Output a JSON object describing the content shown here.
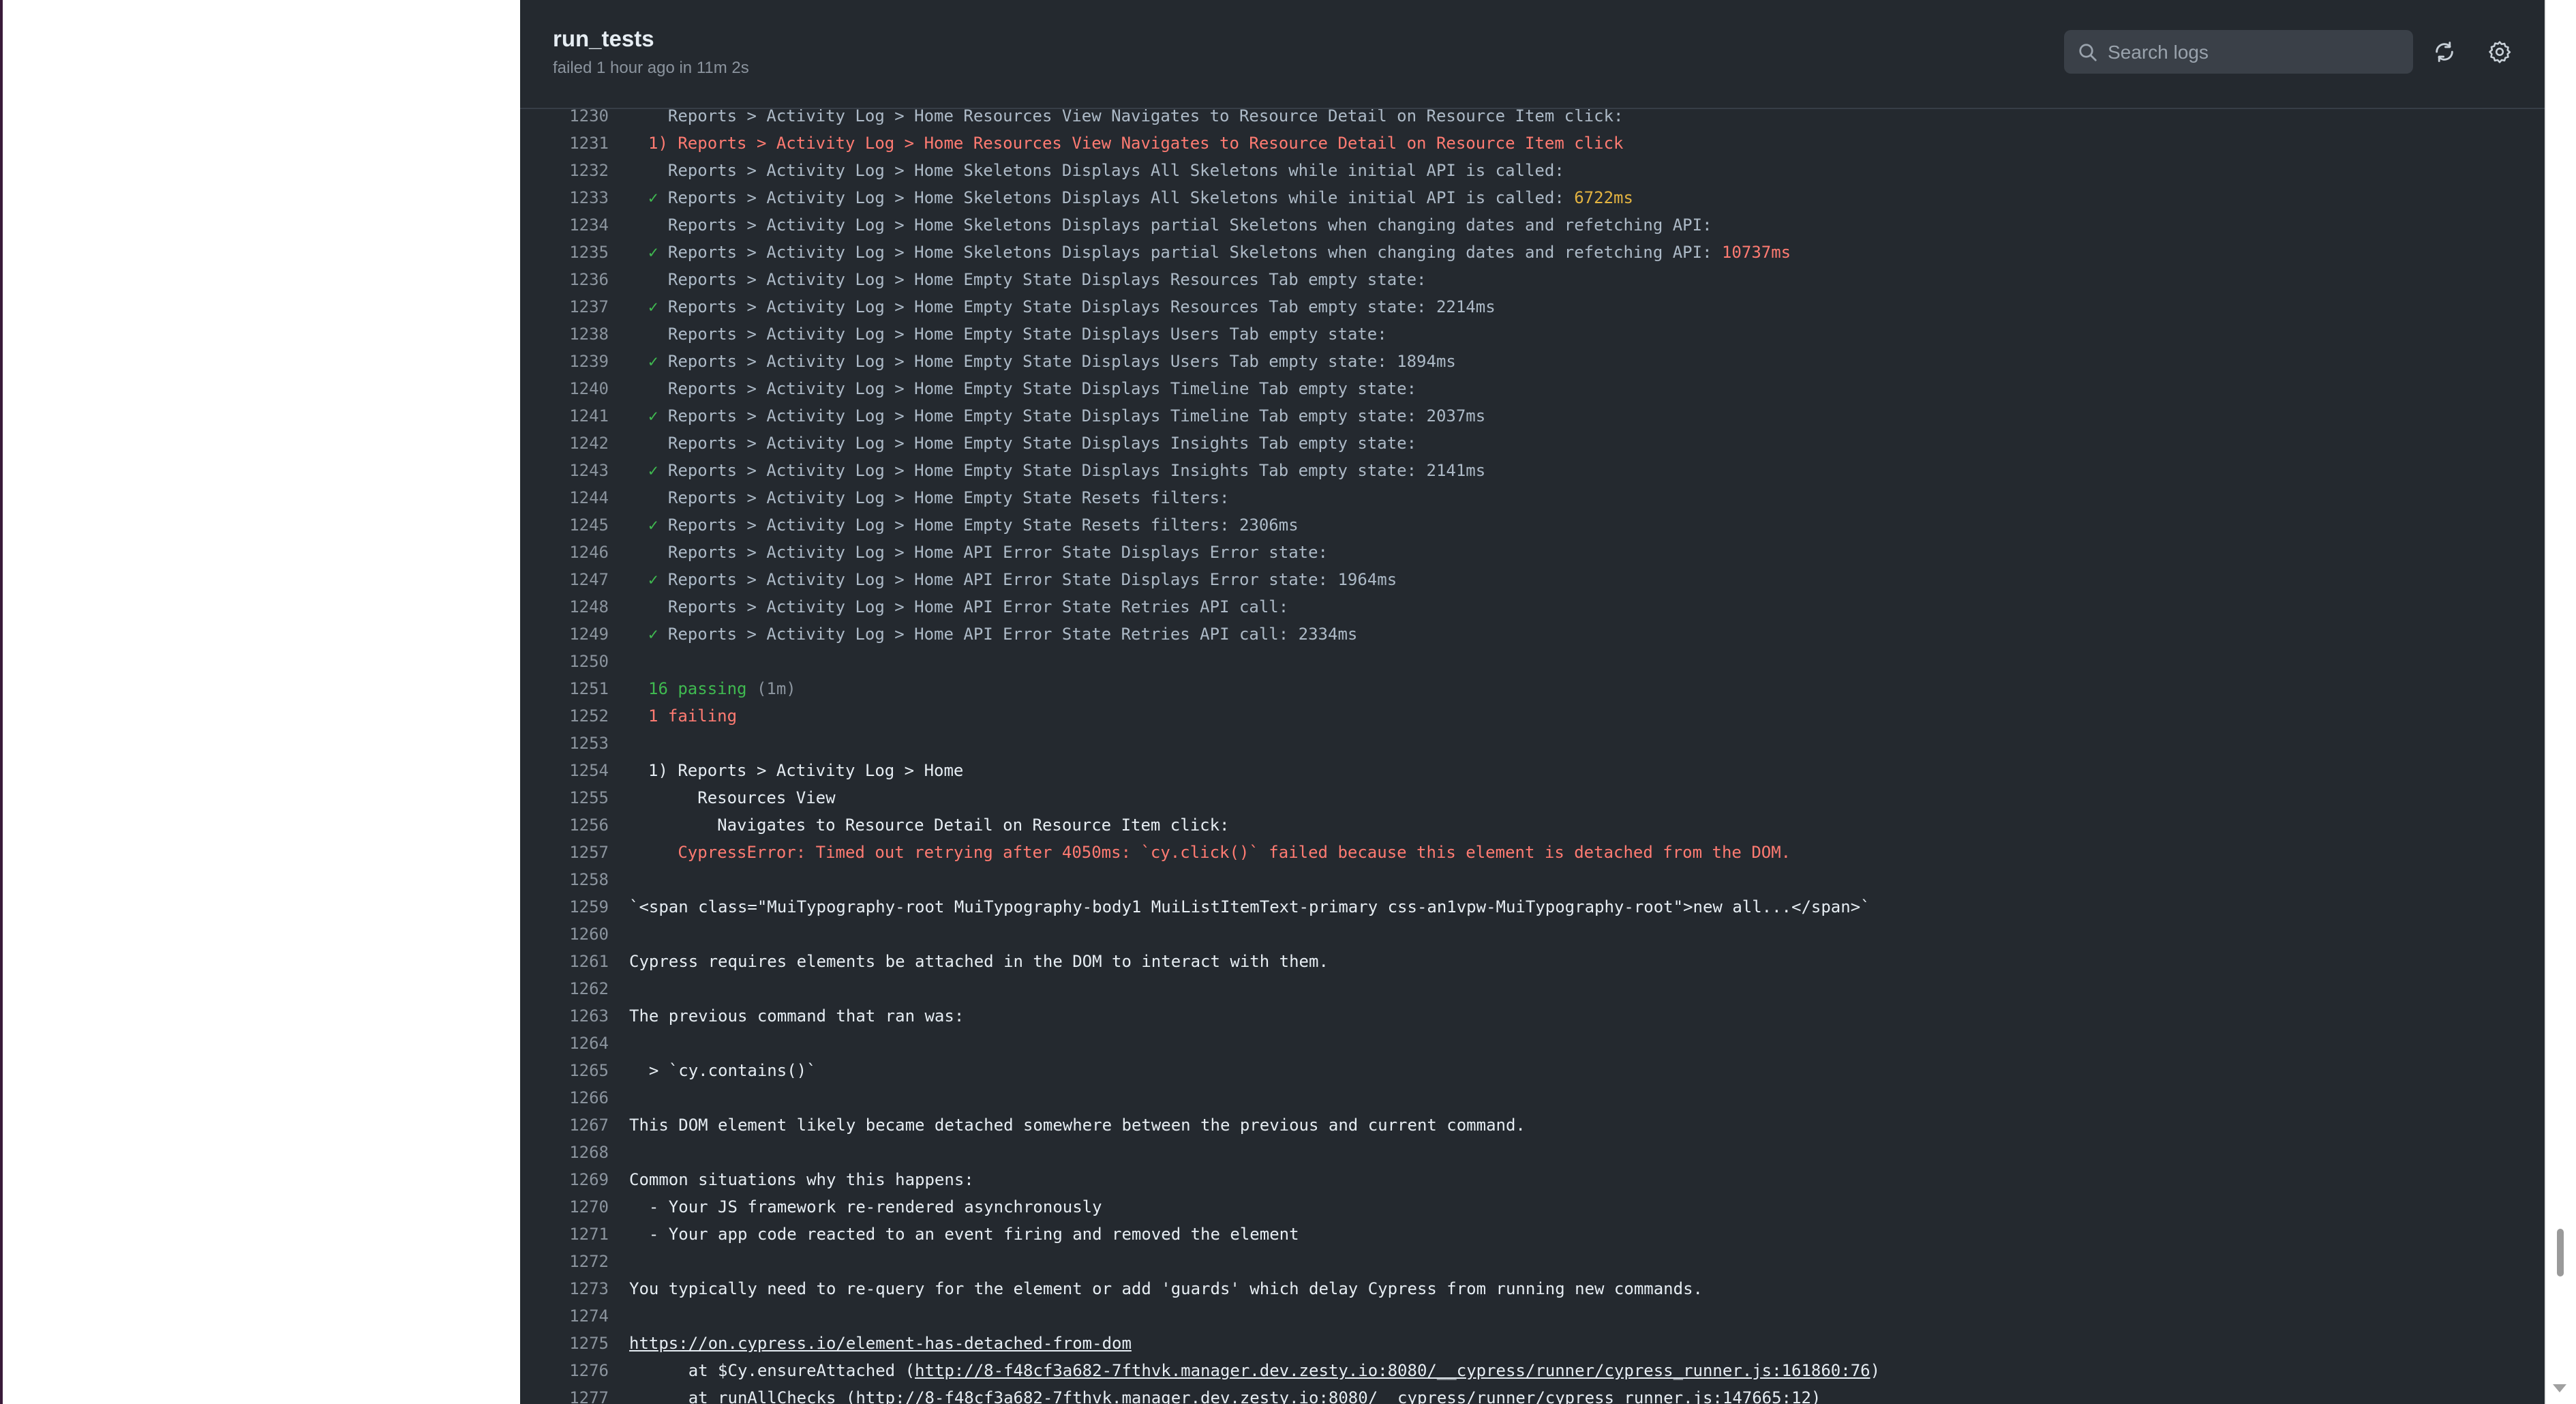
{
  "header": {
    "title": "run_tests",
    "status": "failed 1 hour ago in 11m 2s",
    "search_placeholder": "Search logs",
    "refresh_icon": "refresh-icon",
    "settings_icon": "gear-icon"
  },
  "colors": {
    "panel_bg": "#24292f",
    "fail_red": "#ff7b72",
    "pass_green": "#3fb950",
    "duration_yellow": "#e3b341"
  },
  "log": {
    "lines": [
      {
        "n": "1230",
        "parts": [
          {
            "t": "  Reports > Activity Log > Home Resources View Navigates to Resource Detail on Resource Item click:",
            "c": "dim"
          }
        ]
      },
      {
        "n": "1231",
        "parts": [
          {
            "t": "1) Reports > Activity Log > Home Resources View Navigates to Resource Detail on Resource Item click",
            "c": "red"
          }
        ]
      },
      {
        "n": "1232",
        "parts": [
          {
            "t": "  Reports > Activity Log > Home Skeletons Displays All Skeletons while initial API is called:",
            "c": "dim"
          }
        ]
      },
      {
        "n": "1233",
        "parts": [
          {
            "t": "✓ ",
            "c": "green"
          },
          {
            "t": "Reports > Activity Log > Home Skeletons Displays All Skeletons while initial API is called: ",
            "c": "dim"
          },
          {
            "t": "6722ms",
            "c": "yellow"
          }
        ]
      },
      {
        "n": "1234",
        "parts": [
          {
            "t": "  Reports > Activity Log > Home Skeletons Displays partial Skeletons when changing dates and refetching API:",
            "c": "dim"
          }
        ]
      },
      {
        "n": "1235",
        "parts": [
          {
            "t": "✓ ",
            "c": "green"
          },
          {
            "t": "Reports > Activity Log > Home Skeletons Displays partial Skeletons when changing dates and refetching API: ",
            "c": "dim"
          },
          {
            "t": "10737ms",
            "c": "red"
          }
        ]
      },
      {
        "n": "1236",
        "parts": [
          {
            "t": "  Reports > Activity Log > Home Empty State Displays Resources Tab empty state:",
            "c": "dim"
          }
        ]
      },
      {
        "n": "1237",
        "parts": [
          {
            "t": "✓ ",
            "c": "green"
          },
          {
            "t": "Reports > Activity Log > Home Empty State Displays Resources Tab empty state: 2214ms",
            "c": "dim"
          }
        ]
      },
      {
        "n": "1238",
        "parts": [
          {
            "t": "  Reports > Activity Log > Home Empty State Displays Users Tab empty state:",
            "c": "dim"
          }
        ]
      },
      {
        "n": "1239",
        "parts": [
          {
            "t": "✓ ",
            "c": "green"
          },
          {
            "t": "Reports > Activity Log > Home Empty State Displays Users Tab empty state: 1894ms",
            "c": "dim"
          }
        ]
      },
      {
        "n": "1240",
        "parts": [
          {
            "t": "  Reports > Activity Log > Home Empty State Displays Timeline Tab empty state:",
            "c": "dim"
          }
        ]
      },
      {
        "n": "1241",
        "parts": [
          {
            "t": "✓ ",
            "c": "green"
          },
          {
            "t": "Reports > Activity Log > Home Empty State Displays Timeline Tab empty state: 2037ms",
            "c": "dim"
          }
        ]
      },
      {
        "n": "1242",
        "parts": [
          {
            "t": "  Reports > Activity Log > Home Empty State Displays Insights Tab empty state:",
            "c": "dim"
          }
        ]
      },
      {
        "n": "1243",
        "parts": [
          {
            "t": "✓ ",
            "c": "green"
          },
          {
            "t": "Reports > Activity Log > Home Empty State Displays Insights Tab empty state: 2141ms",
            "c": "dim"
          }
        ]
      },
      {
        "n": "1244",
        "parts": [
          {
            "t": "  Reports > Activity Log > Home Empty State Resets filters:",
            "c": "dim"
          }
        ]
      },
      {
        "n": "1245",
        "parts": [
          {
            "t": "✓ ",
            "c": "green"
          },
          {
            "t": "Reports > Activity Log > Home Empty State Resets filters: 2306ms",
            "c": "dim"
          }
        ]
      },
      {
        "n": "1246",
        "parts": [
          {
            "t": "  Reports > Activity Log > Home API Error State Displays Error state:",
            "c": "dim"
          }
        ]
      },
      {
        "n": "1247",
        "parts": [
          {
            "t": "✓ ",
            "c": "green"
          },
          {
            "t": "Reports > Activity Log > Home API Error State Displays Error state: 1964ms",
            "c": "dim"
          }
        ]
      },
      {
        "n": "1248",
        "parts": [
          {
            "t": "  Reports > Activity Log > Home API Error State Retries API call:",
            "c": "dim"
          }
        ]
      },
      {
        "n": "1249",
        "parts": [
          {
            "t": "✓ ",
            "c": "green"
          },
          {
            "t": "Reports > Activity Log > Home API Error State Retries API call: 2334ms",
            "c": "dim"
          }
        ]
      },
      {
        "n": "1250",
        "parts": []
      },
      {
        "n": "1251",
        "parts": [
          {
            "t": "16 passing ",
            "c": "green"
          },
          {
            "t": "(1m)",
            "c": "gray"
          }
        ]
      },
      {
        "n": "1252",
        "parts": [
          {
            "t": "1 failing",
            "c": "red"
          }
        ]
      },
      {
        "n": "1253",
        "parts": []
      },
      {
        "n": "1254",
        "parts": [
          {
            "t": "1) Reports > Activity Log > Home",
            "c": "plain"
          }
        ]
      },
      {
        "n": "1255",
        "parts": [
          {
            "t": "     Resources View",
            "c": "plain"
          }
        ]
      },
      {
        "n": "1256",
        "parts": [
          {
            "t": "       Navigates to Resource Detail on Resource Item click:",
            "c": "plain"
          }
        ]
      },
      {
        "n": "1257",
        "parts": [
          {
            "t": "   CypressError: Timed out retrying after 4050ms: `cy.click()` failed because this element is detached from the DOM.",
            "c": "red"
          }
        ]
      },
      {
        "n": "1258",
        "parts": []
      },
      {
        "n": "1259",
        "indent": "none",
        "parts": [
          {
            "t": "`<span class=\"MuiTypography-root MuiTypography-body1 MuiListItemText-primary css-an1vpw-MuiTypography-root\">new all...</span>`",
            "c": "plain"
          }
        ]
      },
      {
        "n": "1260",
        "parts": []
      },
      {
        "n": "1261",
        "indent": "none",
        "parts": [
          {
            "t": "Cypress requires elements be attached in the DOM to interact with them.",
            "c": "plain"
          }
        ]
      },
      {
        "n": "1262",
        "parts": []
      },
      {
        "n": "1263",
        "indent": "none",
        "parts": [
          {
            "t": "The previous command that ran was:",
            "c": "plain"
          }
        ]
      },
      {
        "n": "1264",
        "parts": []
      },
      {
        "n": "1265",
        "indent": "none",
        "parts": [
          {
            "t": "  > `cy.contains()`",
            "c": "plain"
          }
        ]
      },
      {
        "n": "1266",
        "parts": []
      },
      {
        "n": "1267",
        "indent": "none",
        "parts": [
          {
            "t": "This DOM element likely became detached somewhere between the previous and current command.",
            "c": "plain"
          }
        ]
      },
      {
        "n": "1268",
        "parts": []
      },
      {
        "n": "1269",
        "indent": "none",
        "parts": [
          {
            "t": "Common situations why this happens:",
            "c": "plain"
          }
        ]
      },
      {
        "n": "1270",
        "indent": "none",
        "parts": [
          {
            "t": "  - Your JS framework re-rendered asynchronously",
            "c": "plain"
          }
        ]
      },
      {
        "n": "1271",
        "indent": "none",
        "parts": [
          {
            "t": "  - Your app code reacted to an event firing and removed the element",
            "c": "plain"
          }
        ]
      },
      {
        "n": "1272",
        "parts": []
      },
      {
        "n": "1273",
        "indent": "none",
        "parts": [
          {
            "t": "You typically need to re-query for the element or add 'guards' which delay Cypress from running new commands.",
            "c": "plain"
          }
        ]
      },
      {
        "n": "1274",
        "parts": []
      },
      {
        "n": "1275",
        "indent": "none",
        "parts": [
          {
            "t": "https://on.cypress.io/element-has-detached-from-dom",
            "c": "link"
          }
        ]
      },
      {
        "n": "1276",
        "indent": "none",
        "parts": [
          {
            "t": "      at $Cy.ensureAttached (",
            "c": "plain"
          },
          {
            "t": "http://8-f48cf3a682-7fthvk.manager.dev.zesty.io:8080/__cypress/runner/cypress_runner.js:161860:76",
            "c": "link"
          },
          {
            "t": ")",
            "c": "plain"
          }
        ]
      },
      {
        "n": "1277",
        "indent": "none",
        "parts": [
          {
            "t": "      at runAllChecks (http://8-f48cf3a682-7fthvk.manager.dev.zesty.io:8080/__cypress/runner/cypress_runner.js:147665:12)",
            "c": "plain"
          }
        ]
      }
    ]
  }
}
